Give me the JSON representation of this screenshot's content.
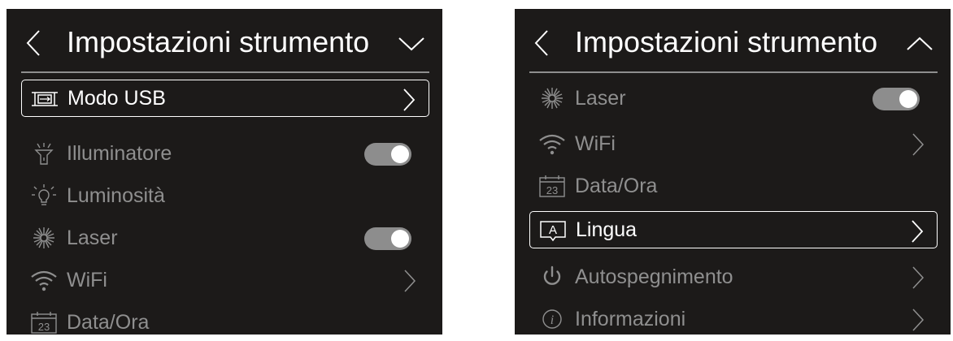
{
  "colors": {
    "panel_bg": "#1c1a19",
    "text_active": "#ffffff",
    "text_inactive": "#8f8f8f",
    "toggle_track": "#8d8d8d"
  },
  "left": {
    "title": "Impostazioni strumento",
    "scroll_icon": "chevron-down-icon",
    "items": [
      {
        "label": "Modo USB",
        "icon": "usb-icon"
      },
      {
        "label": "Illuminatore",
        "icon": "flashlight-icon",
        "toggle_on": true
      },
      {
        "label": "Luminosità",
        "icon": "brightness-bulb-icon"
      },
      {
        "label": "Laser",
        "icon": "laser-icon",
        "toggle_on": true
      },
      {
        "label": "WiFi",
        "icon": "wifi-icon"
      },
      {
        "label": "Data/Ora",
        "icon": "calendar-icon",
        "calendar_day": "23"
      }
    ]
  },
  "right": {
    "title": "Impostazioni strumento",
    "scroll_icon": "chevron-up-icon",
    "items": [
      {
        "label": "Laser",
        "icon": "laser-icon",
        "toggle_on": true
      },
      {
        "label": "WiFi",
        "icon": "wifi-icon"
      },
      {
        "label": "Data/Ora",
        "icon": "calendar-icon",
        "calendar_day": "23"
      },
      {
        "label": "Lingua",
        "icon": "language-icon",
        "icon_letter": "A"
      },
      {
        "label": "Autospegnimento",
        "icon": "power-icon"
      },
      {
        "label": "Informazioni",
        "icon": "info-icon",
        "icon_letter": "i"
      }
    ]
  }
}
